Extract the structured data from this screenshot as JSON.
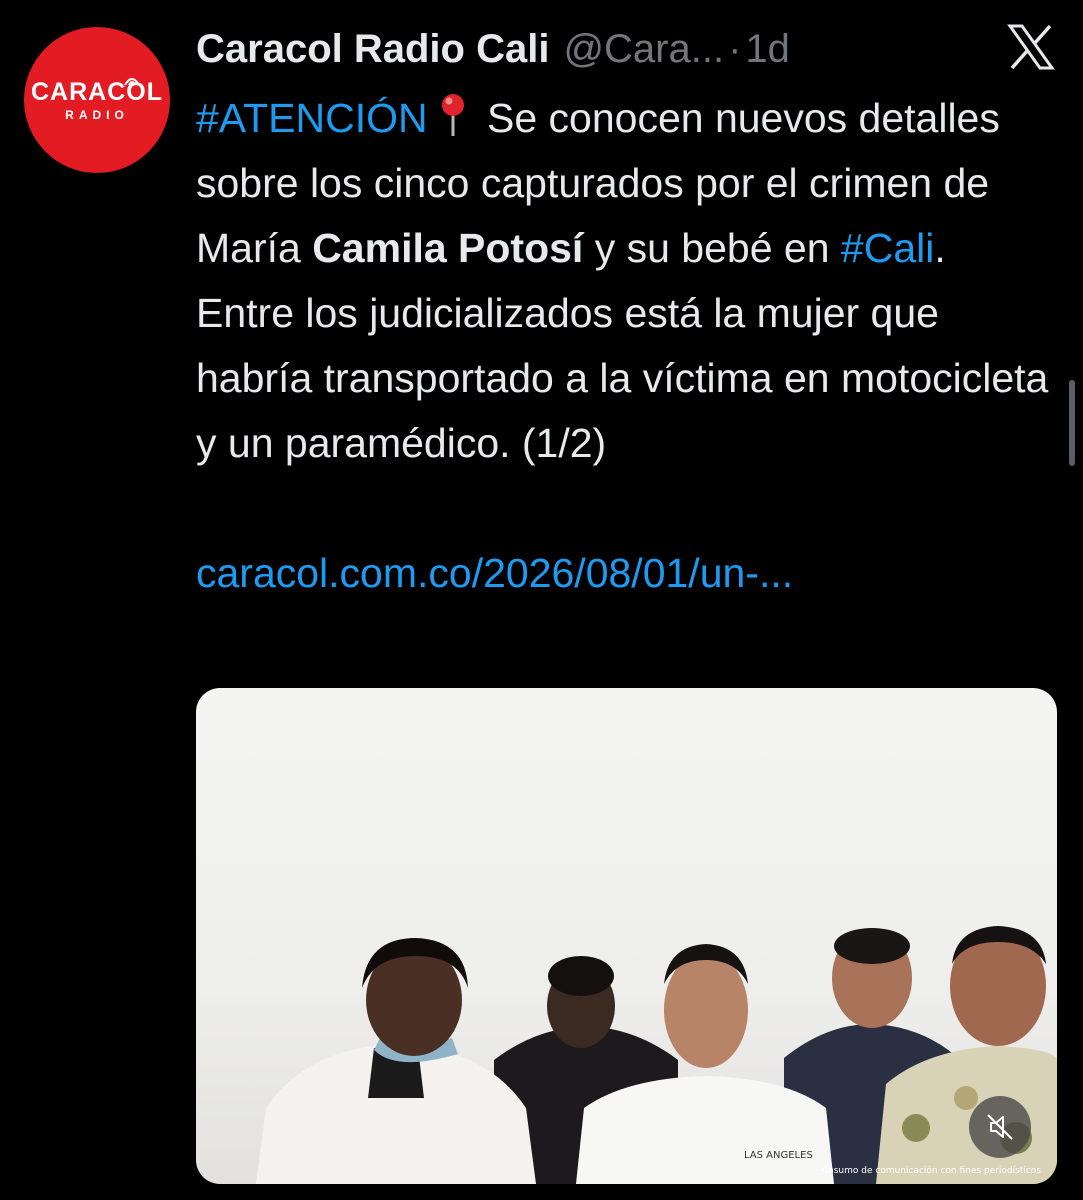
{
  "account": {
    "display_name": "Caracol Radio Cali",
    "handle": "@Cara...",
    "separator": "·",
    "time": "1d",
    "avatar_text_main": "CARACOL",
    "avatar_text_sub": "RADIO",
    "avatar_color": "#e31b23"
  },
  "tweet": {
    "hashtag_1": "#ATENCIÓN",
    "pin_icon": "round-pushpin-emoji",
    "text_1": " Se conocen nuevos detalles sobre los cinco capturados por el crimen de María ",
    "bold_name": "Camila Potosí",
    "text_2": " y su bebé en ",
    "hashtag_2": "#Cali",
    "text_3": ".",
    "paragraph_2": "Entre los judicializados está la mujer que habría transportado a la víctima en motocicleta y un paramédico. (1/2)",
    "link": "caracol.com.co/2026/08/01/un-..."
  },
  "media": {
    "watermark": "•Insumo de comunicación con fines periodísticos",
    "mute_icon": "speaker-muted-icon",
    "shirt_print": "LAS ANGELES"
  },
  "colors": {
    "background": "#000000",
    "text": "#e7e9ea",
    "secondary": "#71767b",
    "link": "#1d9bf0"
  },
  "brand_icon": "x-logo-icon"
}
